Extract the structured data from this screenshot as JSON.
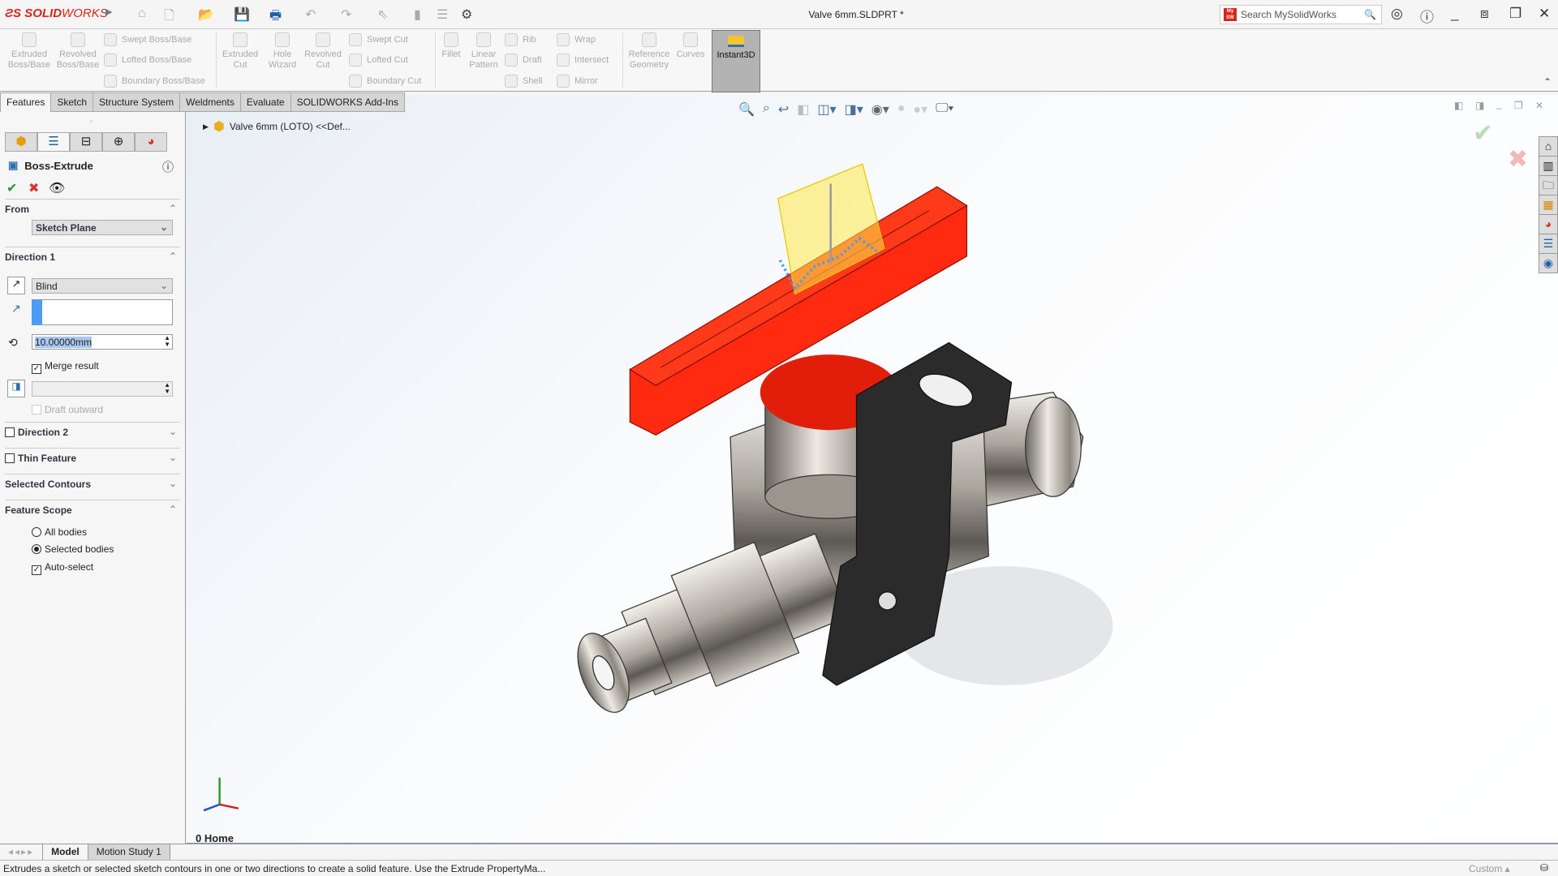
{
  "app": {
    "brand_bold": "SOLID",
    "brand_rest": "WORKS",
    "title": "Valve 6mm.SLDPRT *",
    "search_placeholder": "Search MySolidWorks",
    "mysw": "My SW"
  },
  "ribbon": {
    "large": [
      {
        "label": "Extruded Boss/Base"
      },
      {
        "label": "Revolved Boss/Base"
      },
      {
        "label": "Extruded Cut"
      },
      {
        "label": "Hole Wizard"
      },
      {
        "label": "Revolved Cut"
      },
      {
        "label": "Fillet"
      },
      {
        "label": "Linear Pattern"
      },
      {
        "label": "Reference Geometry"
      },
      {
        "label": "Curves"
      }
    ],
    "small": [
      {
        "label": "Swept Boss/Base"
      },
      {
        "label": "Lofted Boss/Base"
      },
      {
        "label": "Boundary Boss/Base"
      },
      {
        "label": "Swept Cut"
      },
      {
        "label": "Lofted Cut"
      },
      {
        "label": "Boundary Cut"
      },
      {
        "label": "Rib"
      },
      {
        "label": "Draft"
      },
      {
        "label": "Shell"
      },
      {
        "label": "Wrap"
      },
      {
        "label": "Intersect"
      },
      {
        "label": "Mirror"
      }
    ],
    "instant3d": "Instant3D"
  },
  "tabs": [
    {
      "label": "Features",
      "active": true
    },
    {
      "label": "Sketch"
    },
    {
      "label": "Structure System"
    },
    {
      "label": "Weldments"
    },
    {
      "label": "Evaluate"
    },
    {
      "label": "SOLIDWORKS Add-Ins"
    }
  ],
  "panel": {
    "title": "Boss-Extrude",
    "from": {
      "label": "From",
      "value": "Sketch Plane"
    },
    "direction1": {
      "label": "Direction 1",
      "end_condition": "Blind",
      "depth": "10.00000mm",
      "merge_result": "Merge result",
      "merge_checked": true,
      "draft_outward": "Draft outward"
    },
    "direction2": "Direction 2",
    "thin_feature": "Thin Feature",
    "selected_contours": "Selected Contours",
    "feature_scope": {
      "label": "Feature Scope",
      "options": [
        "All bodies",
        "Selected bodies"
      ],
      "selected": "Selected bodies",
      "auto_select": "Auto-select",
      "auto_checked": true
    }
  },
  "viewport": {
    "tree_item": "Valve 6mm (LOTO) <<Def...",
    "view_label": "0 Home"
  },
  "bottom_tabs": [
    "Model",
    "Motion Study 1"
  ],
  "status": {
    "message": "Extrudes a sketch or selected sketch contours in one or two directions to create a solid feature. Use the Extrude PropertyMa...",
    "units": "Custom"
  },
  "colors": {
    "brand": "#d9261c",
    "handle": "#ff2a10",
    "preview": "#ffe84a",
    "highlight": "#4a9cf5"
  }
}
